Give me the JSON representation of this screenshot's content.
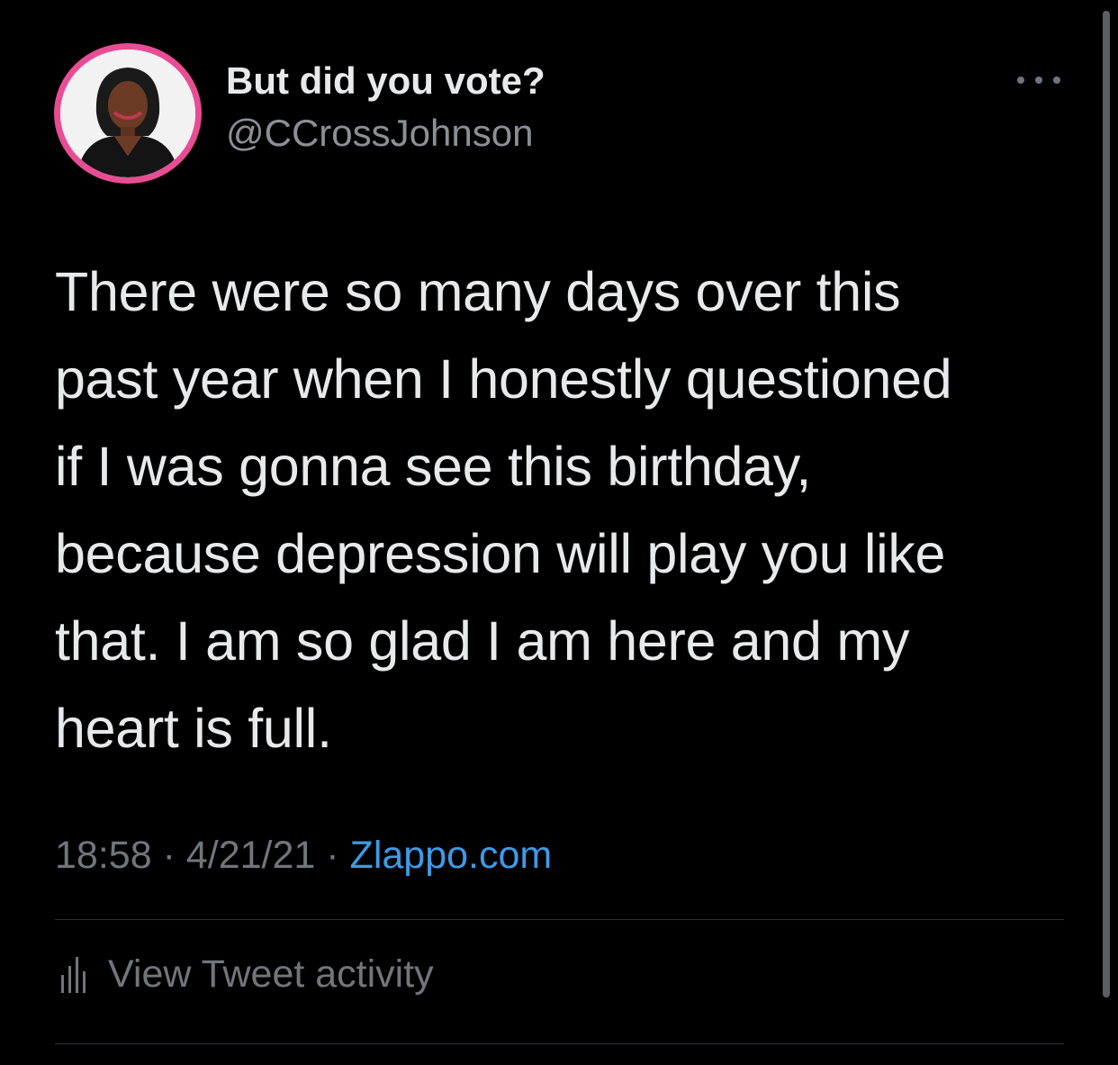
{
  "user": {
    "display_name": "But did you vote?",
    "handle": "@CCrossJohnson",
    "avatar_ring_color": "#e84d93"
  },
  "tweet": {
    "lines": [
      "There were so many days over this",
      "past year when I honestly questioned",
      "if I was gonna see this birthday,",
      "because depression will play you like",
      "that. I am so glad I am here and my",
      "heart is full."
    ],
    "time": "18:58",
    "separator": "·",
    "date": "4/21/21",
    "source": "Zlappo.com",
    "source_color": "#3d9be9"
  },
  "actions": {
    "activity_label": "View Tweet activity",
    "activity_icon": "bar-chart-icon",
    "more_icon": "more-options-icon"
  },
  "theme": {
    "background": "#000000",
    "text": "#e7e9ea",
    "secondary_text": "#71767b"
  }
}
